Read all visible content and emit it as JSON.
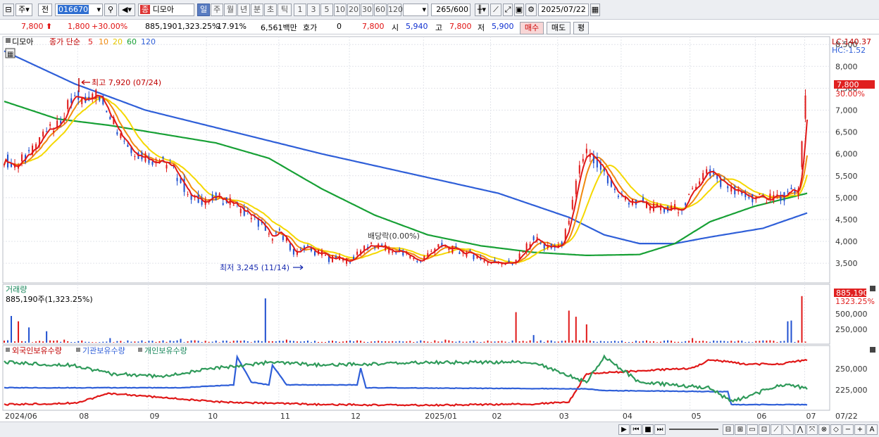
{
  "toolbar": {
    "market_label": "주",
    "prev_label": "전",
    "code": "016670",
    "name": "디모아",
    "name_prefix": "종",
    "periods": [
      "일",
      "주",
      "월",
      "년",
      "분",
      "초",
      "틱"
    ],
    "active_period": "일",
    "intervals": [
      "1",
      "3",
      "5",
      "10",
      "20",
      "30",
      "60",
      "120"
    ],
    "count": "265",
    "count_max": "/600",
    "date": "2025/07/22"
  },
  "quote": {
    "price": "7,800",
    "change": "1,800",
    "change_pct": "+30.00%",
    "volume": "885,190",
    "volume_ratio": "1,323.25%",
    "turnover": "17.91%",
    "amount": "6,561백만",
    "hoga_label": "호가",
    "hoga_value": "0",
    "ask_price": "7,800",
    "open_label": "시",
    "open": "5,940",
    "high_label": "고",
    "high": "7,800",
    "low_label": "저",
    "low": "5,900",
    "buy_label": "매수",
    "sell_label": "매도",
    "eval_label": "평"
  },
  "legend": {
    "name": "디모아",
    "series_label": "종가 단순",
    "ma": [
      {
        "name": "5",
        "color": "#e01818"
      },
      {
        "name": "10",
        "color": "#f08a10"
      },
      {
        "name": "20",
        "color": "#f5d800"
      },
      {
        "name": "60",
        "color": "#17a035"
      },
      {
        "name": "120",
        "color": "#2f5fd8"
      }
    ],
    "lc": "LC:140.37",
    "hc": "HC:-1.52",
    "last_price": "7,800",
    "last_pct": "30.00%"
  },
  "annotations": {
    "high": "최고 7,920 (07/24)",
    "low": "최저 3,245 (11/14)",
    "dividend": "배당락(0.00%)"
  },
  "volume_panel": {
    "title": "거래량",
    "subtitle": "885,190주(1,323.25%)",
    "last_value": "885,190",
    "last_ratio": "1323.25%",
    "ticks": [
      "500,000",
      "250,000"
    ]
  },
  "holdings_panel": {
    "series": [
      {
        "name": "외국인보유수량",
        "color": "#e01818"
      },
      {
        "name": "기관보유수량",
        "color": "#2f5fd8"
      },
      {
        "name": "개인보유수량",
        "color": "#2f9a5a"
      }
    ],
    "ticks": [
      "250,000",
      "225,000"
    ]
  },
  "x_labels": [
    "2024/06",
    "08",
    "09",
    "10",
    "11",
    "12",
    "2025/01",
    "02",
    "03",
    "04",
    "05",
    "06",
    "07",
    "07/22"
  ],
  "chart_data": {
    "type": "candlestick",
    "ylim": [
      3100,
      8600
    ],
    "y_ticks": [
      8500,
      8000,
      7500,
      7000,
      6500,
      6000,
      5500,
      5000,
      4500,
      4000,
      3500
    ],
    "close": [
      [
        0,
        5900
      ],
      [
        5,
        5700
      ],
      [
        10,
        5850
      ],
      [
        15,
        6000
      ],
      [
        20,
        6300
      ],
      [
        25,
        6700
      ],
      [
        30,
        6600
      ],
      [
        35,
        7000
      ],
      [
        40,
        7300
      ],
      [
        45,
        7200
      ],
      [
        50,
        7450
      ],
      [
        55,
        7200
      ],
      [
        60,
        6900
      ],
      [
        65,
        6500
      ],
      [
        70,
        6200
      ],
      [
        75,
        6000
      ],
      [
        80,
        5950
      ],
      [
        85,
        5850
      ],
      [
        90,
        5800
      ],
      [
        95,
        5650
      ],
      [
        100,
        5400
      ],
      [
        105,
        5000
      ],
      [
        110,
        4950
      ],
      [
        115,
        4950
      ],
      [
        120,
        5000
      ],
      [
        125,
        4950
      ],
      [
        130,
        4850
      ],
      [
        135,
        4700
      ],
      [
        140,
        4550
      ],
      [
        145,
        4400
      ],
      [
        150,
        4100
      ],
      [
        155,
        4200
      ],
      [
        160,
        4000
      ],
      [
        165,
        3700
      ],
      [
        170,
        3900
      ],
      [
        175,
        3750
      ],
      [
        180,
        3700
      ],
      [
        185,
        3600
      ],
      [
        190,
        3650
      ],
      [
        195,
        3500
      ],
      [
        200,
        3750
      ],
      [
        205,
        3850
      ],
      [
        210,
        3900
      ],
      [
        215,
        3850
      ],
      [
        220,
        3750
      ],
      [
        225,
        3800
      ],
      [
        230,
        3600
      ],
      [
        235,
        3550
      ],
      [
        240,
        3700
      ],
      [
        245,
        3900
      ],
      [
        250,
        3850
      ],
      [
        255,
        3800
      ],
      [
        260,
        3750
      ],
      [
        265,
        3700
      ],
      [
        270,
        3600
      ],
      [
        275,
        3500
      ],
      [
        280,
        3550
      ],
      [
        285,
        3500
      ],
      [
        290,
        3550
      ],
      [
        295,
        3800
      ],
      [
        300,
        4100
      ],
      [
        305,
        3900
      ],
      [
        310,
        3850
      ],
      [
        315,
        3900
      ],
      [
        320,
        4400
      ],
      [
        325,
        5600
      ],
      [
        330,
        6000
      ],
      [
        335,
        5800
      ],
      [
        340,
        5500
      ],
      [
        345,
        5200
      ],
      [
        350,
        5000
      ],
      [
        355,
        4850
      ],
      [
        360,
        4950
      ],
      [
        365,
        4800
      ],
      [
        370,
        4750
      ],
      [
        375,
        4700
      ],
      [
        380,
        4750
      ],
      [
        385,
        4800
      ],
      [
        390,
        5200
      ],
      [
        395,
        5500
      ],
      [
        400,
        5600
      ],
      [
        405,
        5400
      ],
      [
        410,
        5250
      ],
      [
        415,
        5100
      ],
      [
        420,
        5050
      ],
      [
        425,
        5000
      ],
      [
        430,
        4950
      ],
      [
        435,
        5050
      ],
      [
        440,
        5000
      ],
      [
        445,
        5100
      ],
      [
        450,
        5150
      ],
      [
        455,
        7800
      ]
    ],
    "ma120": [
      [
        0,
        8350
      ],
      [
        40,
        7600
      ],
      [
        80,
        7000
      ],
      [
        130,
        6500
      ],
      [
        180,
        6000
      ],
      [
        230,
        5550
      ],
      [
        280,
        5100
      ],
      [
        320,
        4550
      ],
      [
        340,
        4150
      ],
      [
        360,
        3950
      ],
      [
        380,
        3950
      ],
      [
        400,
        4100
      ],
      [
        430,
        4300
      ],
      [
        455,
        4650
      ]
    ],
    "ma60": [
      [
        0,
        7200
      ],
      [
        30,
        6800
      ],
      [
        60,
        6650
      ],
      [
        90,
        6450
      ],
      [
        120,
        6250
      ],
      [
        150,
        5900
      ],
      [
        180,
        5200
      ],
      [
        210,
        4600
      ],
      [
        240,
        4150
      ],
      [
        270,
        3900
      ],
      [
        300,
        3750
      ],
      [
        330,
        3680
      ],
      [
        360,
        3700
      ],
      [
        380,
        3950
      ],
      [
        400,
        4450
      ],
      [
        425,
        4800
      ],
      [
        455,
        5100
      ]
    ],
    "volume": [
      [
        4,
        350000
      ],
      [
        9,
        280000
      ],
      [
        15,
        200000
      ],
      [
        25,
        150000
      ],
      [
        35,
        40000
      ],
      [
        60,
        60000
      ],
      [
        70,
        30000
      ],
      [
        100,
        50000
      ],
      [
        148,
        580000
      ],
      [
        160,
        40000
      ],
      [
        200,
        30000
      ],
      [
        250,
        40000
      ],
      [
        290,
        400000
      ],
      [
        300,
        100000
      ],
      [
        320,
        420000
      ],
      [
        325,
        340000
      ],
      [
        330,
        240000
      ],
      [
        390,
        60000
      ],
      [
        444,
        280000
      ],
      [
        447,
        290000
      ],
      [
        453,
        610000
      ]
    ],
    "volume_ylim": [
      0,
      700000
    ]
  }
}
